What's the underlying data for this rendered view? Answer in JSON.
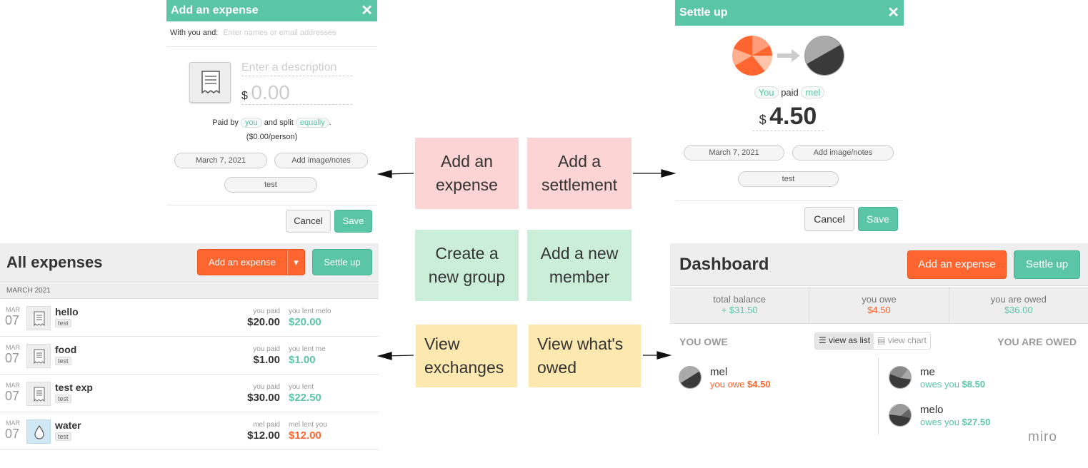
{
  "expense_modal": {
    "title": "Add an expense",
    "close": "✕",
    "with_label": "With you and:",
    "with_placeholder": "Enter names or email addresses",
    "description_placeholder": "Enter a description",
    "currency": "$",
    "amount_placeholder": "0.00",
    "paid_by_prefix": "Paid by",
    "paid_by": "you",
    "split_text": "and split",
    "split": "equally",
    "per_person": "($0.00/person)",
    "date": "March 7, 2021",
    "add_notes": "Add image/notes",
    "group": "test",
    "cancel": "Cancel",
    "save": "Save"
  },
  "settle_modal": {
    "title": "Settle up",
    "close": "✕",
    "payer": "You",
    "paid_word": "paid",
    "payee": "mel",
    "currency": "$",
    "amount": "4.50",
    "date": "March 7, 2021",
    "add_notes": "Add image/notes",
    "group": "test",
    "cancel": "Cancel",
    "save": "Save"
  },
  "notes": {
    "add_expense": "Add an expense",
    "add_settlement": "Add a settlement",
    "create_group": "Create a new group",
    "add_member": "Add a new member",
    "view_exchanges": "View exchanges",
    "view_owed": "View what's owed"
  },
  "all_expenses": {
    "title": "All expenses",
    "add_button": "Add an expense",
    "dropdown_caret": "▾",
    "settle_button": "Settle up",
    "month_header": "MARCH 2021",
    "rows": [
      {
        "mon": "MAR",
        "day": "07",
        "name": "hello",
        "tag": "test",
        "paid_label": "you paid",
        "paid": "$20.00",
        "lent_label": "you lent melo",
        "lent": "$20.00",
        "kind": "receipt"
      },
      {
        "mon": "MAR",
        "day": "07",
        "name": "food",
        "tag": "test",
        "paid_label": "you paid",
        "paid": "$1.00",
        "lent_label": "you lent me",
        "lent": "$1.00",
        "kind": "receipt"
      },
      {
        "mon": "MAR",
        "day": "07",
        "name": "test exp",
        "tag": "test",
        "paid_label": "you paid",
        "paid": "$30.00",
        "lent_label": "you lent",
        "lent": "$22.50",
        "kind": "receipt"
      },
      {
        "mon": "MAR",
        "day": "07",
        "name": "water",
        "tag": "test",
        "paid_label": "mel paid",
        "paid": "$12.00",
        "lent_label": "mel lent you",
        "lent": "$12.00",
        "kind": "water"
      }
    ]
  },
  "dashboard": {
    "title": "Dashboard",
    "add_button": "Add an expense",
    "settle_button": "Settle up",
    "total_balance_label": "total balance",
    "total_balance": "+ $31.50",
    "you_owe_label": "you owe",
    "you_owe": "$4.50",
    "you_are_owed_label": "you are owed",
    "you_are_owed": "$36.00",
    "owe_heading": "YOU OWE",
    "owed_heading": "YOU ARE OWED",
    "view_list": "view as list",
    "view_chart": "view chart",
    "owe_items": [
      {
        "name": "mel",
        "text": "you owe",
        "amount": "$4.50"
      }
    ],
    "owed_items": [
      {
        "name": "me",
        "text": "owes you",
        "amount": "$8.50"
      },
      {
        "name": "melo",
        "text": "owes you",
        "amount": "$27.50"
      }
    ]
  },
  "watermark": "miro",
  "colors": {
    "green": "#5bc5a7",
    "orange": "#ff652f",
    "pink_note": "#fdd4d4",
    "green_note": "#cbeed9",
    "yellow_note": "#fde9b0"
  }
}
